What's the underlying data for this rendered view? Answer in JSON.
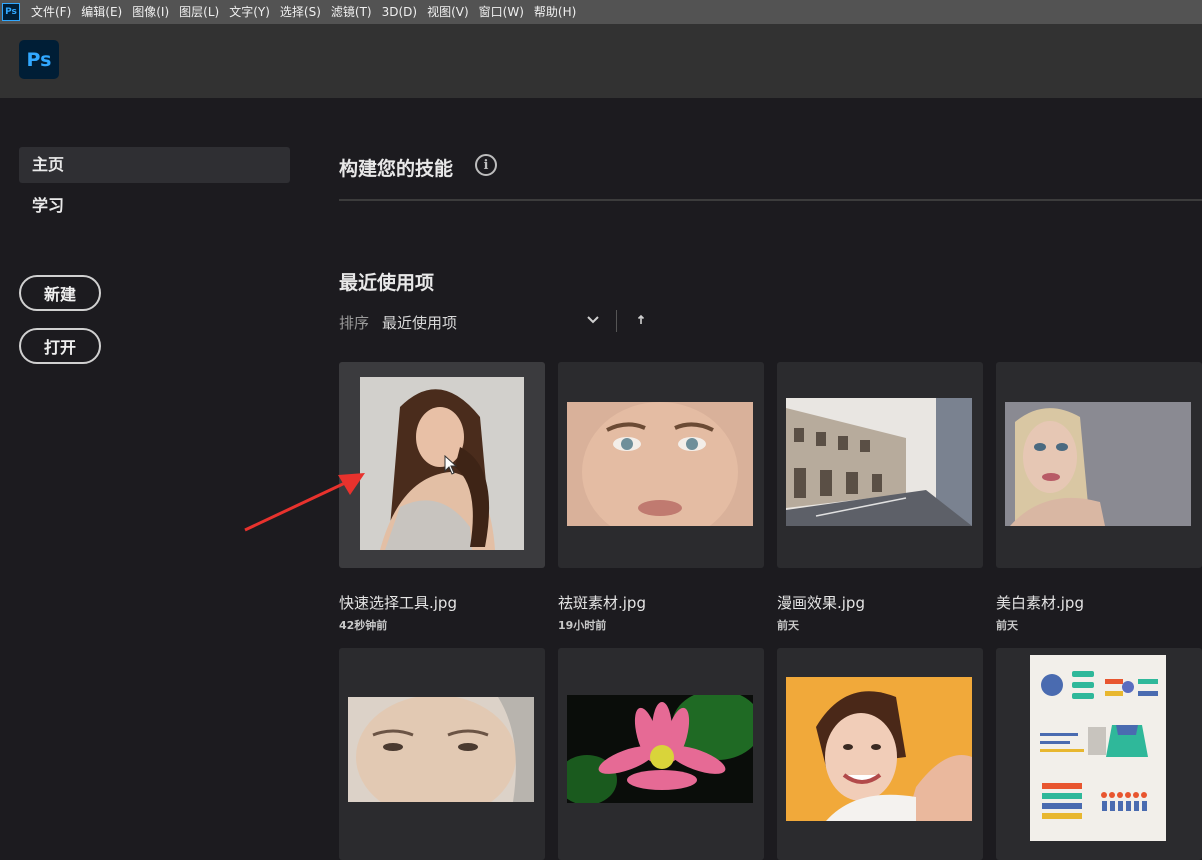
{
  "menubar": {
    "app_icon": "Ps",
    "items": [
      "文件(F)",
      "编辑(E)",
      "图像(I)",
      "图层(L)",
      "文字(Y)",
      "选择(S)",
      "滤镜(T)",
      "3D(D)",
      "视图(V)",
      "窗口(W)",
      "帮助(H)"
    ]
  },
  "header": {
    "logo": "Ps"
  },
  "sidebar": {
    "nav": [
      "主页",
      "学习"
    ],
    "buttons": {
      "new": "新建",
      "open": "打开"
    }
  },
  "main": {
    "skills_title": "构建您的技能",
    "info_icon": "i",
    "recent_title": "最近使用项",
    "sort": {
      "label": "排序",
      "value": "最近使用项"
    }
  },
  "files": [
    {
      "name": "快速选择工具.jpg",
      "time": "42秒钟前"
    },
    {
      "name": "祛斑素材.jpg",
      "time": "19小时前"
    },
    {
      "name": "漫画效果.jpg",
      "time": "前天"
    },
    {
      "name": "美白素材.jpg",
      "time": "前天"
    }
  ],
  "colors": {
    "accent": "#31a8ff",
    "annotation_arrow": "#e8322d"
  }
}
